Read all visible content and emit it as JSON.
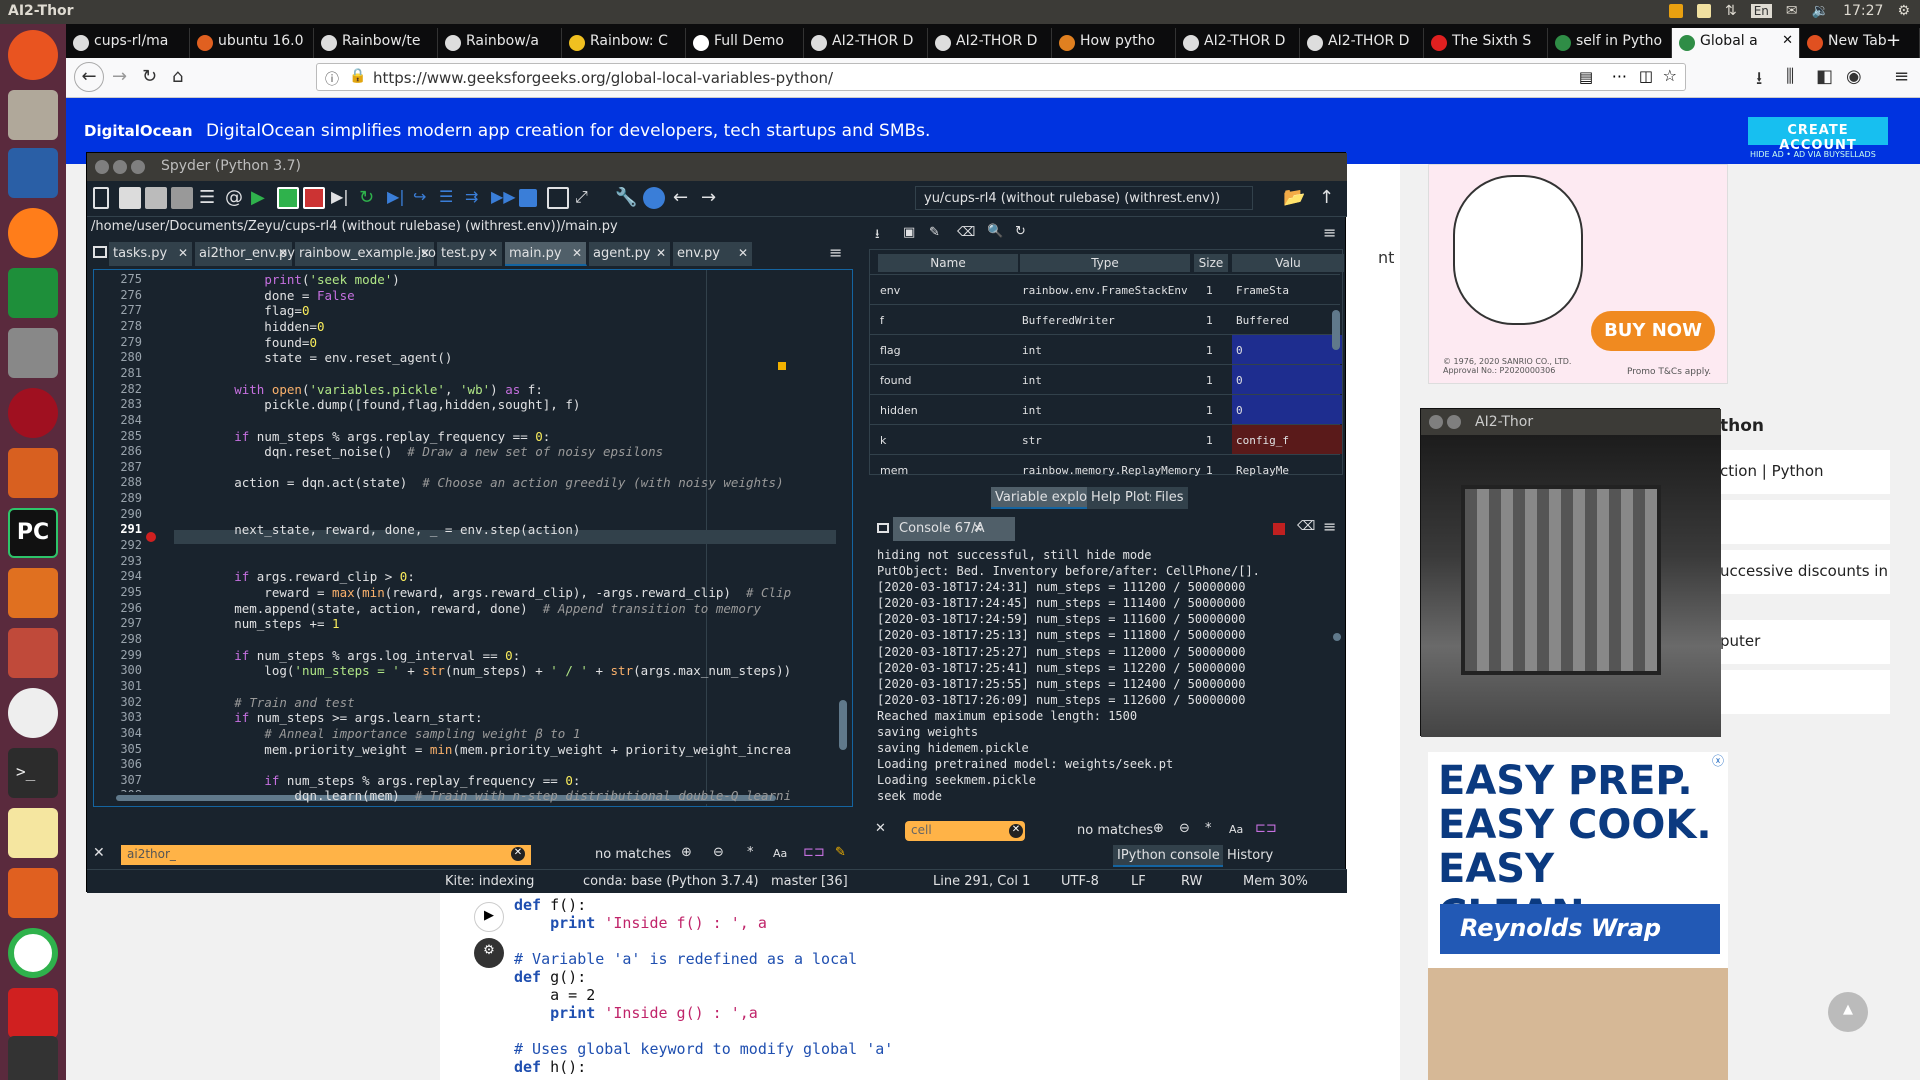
{
  "topbar": {
    "title": "AI2-Thor",
    "lang": "En",
    "time": "17:27"
  },
  "browser": {
    "tabs": [
      {
        "label": "cups-rl/ma"
      },
      {
        "label": "ubuntu 16.0"
      },
      {
        "label": "Rainbow/te"
      },
      {
        "label": "Rainbow/a"
      },
      {
        "label": "Rainbow: C"
      },
      {
        "label": "Full Demo"
      },
      {
        "label": "AI2-THOR D"
      },
      {
        "label": "AI2-THOR D"
      },
      {
        "label": "How pytho"
      },
      {
        "label": "AI2-THOR D"
      },
      {
        "label": "AI2-THOR D"
      },
      {
        "label": "The Sixth S"
      },
      {
        "label": "self in Pytho"
      },
      {
        "label": "Global a"
      },
      {
        "label": "New Tab"
      }
    ],
    "url": "https://www.geeksforgeeks.org/global-local-variables-python/"
  },
  "page": {
    "ad": {
      "brand": "DigitalOcean",
      "text": "DigitalOcean simplifies modern app creation for developers, tech startups and SMBs.",
      "button": "CREATE ACCOUNT",
      "hide": "HIDE AD • AD VIA BUYSELLADS"
    },
    "side_ad": {
      "buy_now": "BUY NOW",
      "copyright": "© 1976, 2020 SANRIO CO., LTD. Approval No.: P2020000306",
      "promo": "Promo T&Cs apply."
    },
    "side_heading": "thon",
    "nt_fragment": "nt",
    "side_links": [
      "ction | Python",
      "uccessive discounts in",
      "puter"
    ],
    "ad2": {
      "line1": "EASY PREP.",
      "line2": "EASY COOK.",
      "line3": "EASY CLEAN.",
      "brand": "Reynolds Wrap"
    },
    "code_lines": [
      {
        "kw": "def ",
        "rest": "f():"
      },
      {
        "kw": "    print ",
        "rest": "'Inside f() : ', a"
      },
      {
        "kw": "",
        "rest": "# Variable 'a' is redefined as a local"
      },
      {
        "kw": "def ",
        "rest": "g():"
      },
      {
        "kw": "",
        "rest": "    a = 2"
      },
      {
        "kw": "    print ",
        "rest": "'Inside g() : ',a"
      },
      {
        "kw": "",
        "rest": "# Uses global keyword to modify global 'a'"
      },
      {
        "kw": "def ",
        "rest": "h():"
      }
    ]
  },
  "spyder": {
    "title": "Spyder (Python 3.7)",
    "workdir": "yu/cups-rl4 (without rulebase) (withrest.env))",
    "filepath": "/home/user/Documents/Zeyu/cups-rl4 (without rulebase) (withrest.env))/main.py",
    "editor_tabs": [
      "tasks.py",
      "ai2thor_env.py",
      "rainbow_example.json",
      "test.py",
      "main.py",
      "agent.py",
      "env.py"
    ],
    "active_tab": "main.py",
    "code": [
      {
        "n": "275",
        "t": "            print('seek mode')"
      },
      {
        "n": "276",
        "t": "            done = False"
      },
      {
        "n": "277",
        "t": "            flag=0"
      },
      {
        "n": "278",
        "t": "            hidden=0"
      },
      {
        "n": "279",
        "t": "            found=0"
      },
      {
        "n": "280",
        "t": "            state = env.reset_agent()"
      },
      {
        "n": "281",
        "t": ""
      },
      {
        "n": "282",
        "t": "        with open('variables.pickle', 'wb') as f:"
      },
      {
        "n": "283",
        "t": "            pickle.dump([found,flag,hidden,sought], f)"
      },
      {
        "n": "284",
        "t": ""
      },
      {
        "n": "285",
        "t": "        if num_steps % args.replay_frequency == 0:"
      },
      {
        "n": "286",
        "t": "            dqn.reset_noise()  # Draw a new set of noisy epsilons"
      },
      {
        "n": "287",
        "t": ""
      },
      {
        "n": "288",
        "t": "        action = dqn.act(state)  # Choose an action greedily (with noisy weights)"
      },
      {
        "n": "289",
        "t": ""
      },
      {
        "n": "290",
        "t": ""
      },
      {
        "n": "291",
        "t": "        next_state, reward, done, _ = env.step(action)"
      },
      {
        "n": "292",
        "t": ""
      },
      {
        "n": "293",
        "t": ""
      },
      {
        "n": "294",
        "t": "        if args.reward_clip > 0:"
      },
      {
        "n": "295",
        "t": "            reward = max(min(reward, args.reward_clip), -args.reward_clip)  # Clip"
      },
      {
        "n": "296",
        "t": "        mem.append(state, action, reward, done)  # Append transition to memory"
      },
      {
        "n": "297",
        "t": "        num_steps += 1"
      },
      {
        "n": "298",
        "t": ""
      },
      {
        "n": "299",
        "t": "        if num_steps % args.log_interval == 0:"
      },
      {
        "n": "300",
        "t": "            log('num_steps = ' + str(num_steps) + ' / ' + str(args.max_num_steps))"
      },
      {
        "n": "301",
        "t": ""
      },
      {
        "n": "302",
        "t": "        # Train and test"
      },
      {
        "n": "303",
        "t": "        if num_steps >= args.learn_start:"
      },
      {
        "n": "304",
        "t": "            # Anneal importance sampling weight β to 1"
      },
      {
        "n": "305",
        "t": "            mem.priority_weight = min(mem.priority_weight + priority_weight_increa"
      },
      {
        "n": "306",
        "t": ""
      },
      {
        "n": "307",
        "t": "            if num_steps % args.replay_frequency == 0:"
      },
      {
        "n": "308",
        "t": "                dqn.learn(mem)  # Train with n-step distributional double-Q learni"
      }
    ],
    "editor_find": "ai2thor_",
    "editor_find_result": "no matches",
    "var_headers": [
      "Name",
      "Type",
      "Size",
      "Valu"
    ],
    "vars": [
      {
        "name": "env",
        "type": "rainbow.env.FrameStackEnv",
        "size": "1",
        "value": "FrameSta"
      },
      {
        "name": "f",
        "type": "BufferedWriter",
        "size": "1",
        "value": "Buffered"
      },
      {
        "name": "flag",
        "type": "int",
        "size": "1",
        "value": "0"
      },
      {
        "name": "found",
        "type": "int",
        "size": "1",
        "value": "0"
      },
      {
        "name": "hidden",
        "type": "int",
        "size": "1",
        "value": "0"
      },
      {
        "name": "k",
        "type": "str",
        "size": "1",
        "value": "config_f"
      },
      {
        "name": "mem",
        "type": "rainbow.memory.ReplayMemory",
        "size": "1",
        "value": "ReplayMe"
      }
    ],
    "pane_tabs": [
      "Variable explorer",
      "Help",
      "Plots",
      "Files"
    ],
    "console_tab": "Console 67/A",
    "console_lines": [
      "hiding not successful, still hide mode",
      "PutObject: Bed. Inventory before/after: CellPhone/[].",
      "[2020-03-18T17:24:31] num_steps = 111200 / 50000000",
      "[2020-03-18T17:24:45] num_steps = 111400 / 50000000",
      "[2020-03-18T17:24:59] num_steps = 111600 / 50000000",
      "[2020-03-18T17:25:13] num_steps = 111800 / 50000000",
      "[2020-03-18T17:25:27] num_steps = 112000 / 50000000",
      "[2020-03-18T17:25:41] num_steps = 112200 / 50000000",
      "[2020-03-18T17:25:55] num_steps = 112400 / 50000000",
      "[2020-03-18T17:26:09] num_steps = 112600 / 50000000",
      "Reached maximum episode length: 1500",
      "saving weights",
      "saving hidemem.pickle",
      "Loading pretrained model: weights/seek.pt",
      "Loading seekmem.pickle",
      "seek mode"
    ],
    "console_find": "cell",
    "console_find_result": "no matches",
    "console_tabs": [
      "IPython console",
      "History"
    ],
    "status": {
      "kite": "Kite: indexing",
      "conda": "conda: base (Python 3.7.4)",
      "git": "master [36]",
      "pos": "Line 291, Col 1",
      "enc": "UTF-8",
      "eol": "LF",
      "rw": "RW",
      "mem": "Mem 30%"
    }
  },
  "ai2thor_window": {
    "title": "AI2-Thor"
  }
}
